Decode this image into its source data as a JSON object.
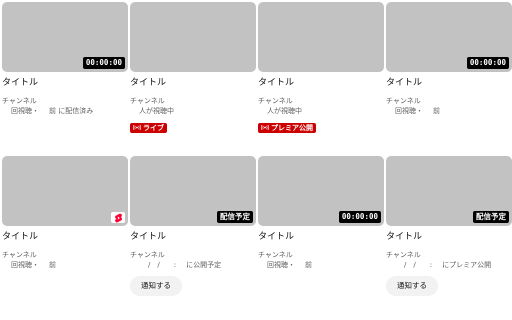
{
  "cards": [
    {
      "duration": "00:00:00",
      "title": "タイトル",
      "channel": "チャンネル",
      "meta": "回視聴・",
      "meta_suffix": "前 に配信済み"
    },
    {
      "title": "タイトル",
      "channel": "チャンネル",
      "meta": "人が視聴中",
      "badge": "ライブ"
    },
    {
      "title": "タイトル",
      "channel": "チャンネル",
      "meta": "人が視聴中",
      "badge": "プレミア公開"
    },
    {
      "duration": "00:00:00",
      "title": "タイトル",
      "channel": "チャンネル",
      "meta": "回視聴・",
      "meta_suffix": "前"
    },
    {
      "title": "タイトル",
      "channel": "チャンネル",
      "meta": "回視聴・",
      "meta_suffix": "前"
    },
    {
      "duration": "配信予定",
      "title": "タイトル",
      "channel": "チャンネル",
      "meta": "/　/　　:",
      "meta_suffix": "に公開予定",
      "button": "通知する"
    },
    {
      "duration": "00:00:00",
      "title": "タイトル",
      "channel": "チャンネル",
      "meta": "回視聴・",
      "meta_suffix": "前"
    },
    {
      "duration": "配信予定",
      "title": "タイトル",
      "channel": "チャンネル",
      "meta": "/　/　　:",
      "meta_suffix": "にプレミア公開",
      "button": "通知する"
    }
  ],
  "colors": {
    "thumbnail": "#c2c2c2",
    "badge_red": "#cc0000",
    "duration_bg": "#000000"
  },
  "icons": {
    "live_badge": "broadcast-icon",
    "shorts": "shorts-icon"
  }
}
